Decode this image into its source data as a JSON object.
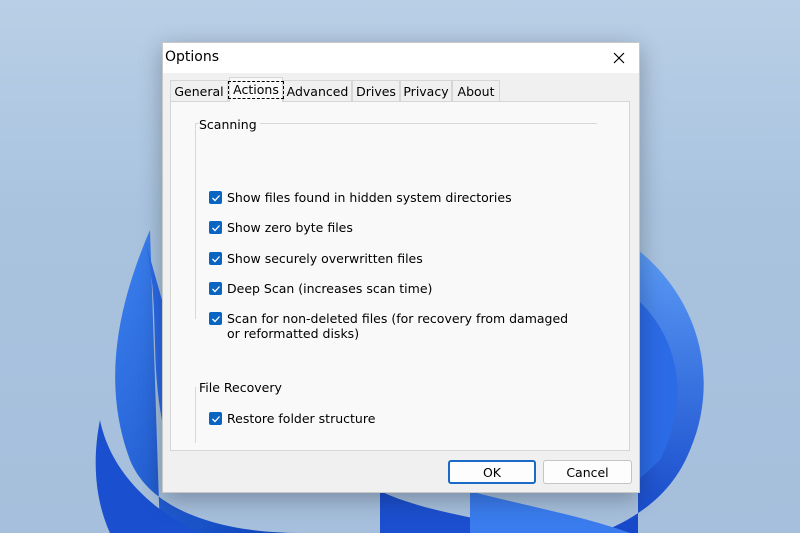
{
  "dialog": {
    "title": "Options",
    "close_icon": "close-icon"
  },
  "tabs": [
    {
      "label": "General",
      "active": false
    },
    {
      "label": "Actions",
      "active": true
    },
    {
      "label": "Advanced",
      "active": false
    },
    {
      "label": "Drives",
      "active": false
    },
    {
      "label": "Privacy",
      "active": false
    },
    {
      "label": "About",
      "active": false
    }
  ],
  "scanning": {
    "label": "Scanning",
    "options": [
      {
        "label": "Show files found in hidden system directories",
        "checked": true
      },
      {
        "label": "Show zero byte files",
        "checked": true
      },
      {
        "label": "Show securely overwritten files",
        "checked": true
      },
      {
        "label": "Deep Scan (increases scan time)",
        "checked": true
      },
      {
        "label": "Scan for non-deleted files (for recovery from damaged or reformatted disks)",
        "checked": true
      }
    ]
  },
  "file_recovery": {
    "label": "File Recovery",
    "options": [
      {
        "label": "Restore folder structure",
        "checked": true
      }
    ]
  },
  "buttons": {
    "ok": "OK",
    "cancel": "Cancel"
  },
  "colors": {
    "accent": "#0a64c2",
    "wallpaper_blue": "#1f5fe0"
  }
}
